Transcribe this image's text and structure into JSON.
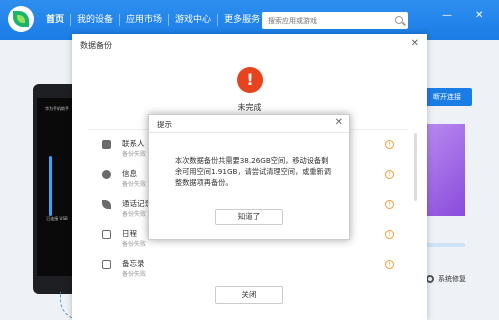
{
  "nav": {
    "items": [
      "首页",
      "我的设备",
      "应用市场",
      "游戏中心",
      "更多服务"
    ]
  },
  "search": {
    "placeholder": "搜索应用或游戏"
  },
  "phone": {
    "header": "华为手机助手",
    "usb_text": "已连接 USB"
  },
  "right_panel": {
    "connect_label": "断开连接",
    "repair_label": "系统修复"
  },
  "backup_panel": {
    "title": "数据备份",
    "status": "未完成",
    "rows": [
      {
        "name": "联系人",
        "sub": "备份失败"
      },
      {
        "name": "信息",
        "sub": "备份失败"
      },
      {
        "name": "通话记录",
        "sub": "备份失败"
      },
      {
        "name": "日程",
        "sub": "备份失败"
      },
      {
        "name": "备忘录",
        "sub": "备份失败"
      }
    ],
    "close_label": "关闭"
  },
  "modal": {
    "title": "提示",
    "message": "本次数据备份共需要38.26GB空间，移动设备剩余可用空间1.91GB，请尝试清理空间，或重新调整数据项再备份。",
    "ok_label": "知道了"
  },
  "colors": {
    "primary": "#1a7de6",
    "warning": "#e8431f",
    "info_orange": "#f09c35"
  }
}
